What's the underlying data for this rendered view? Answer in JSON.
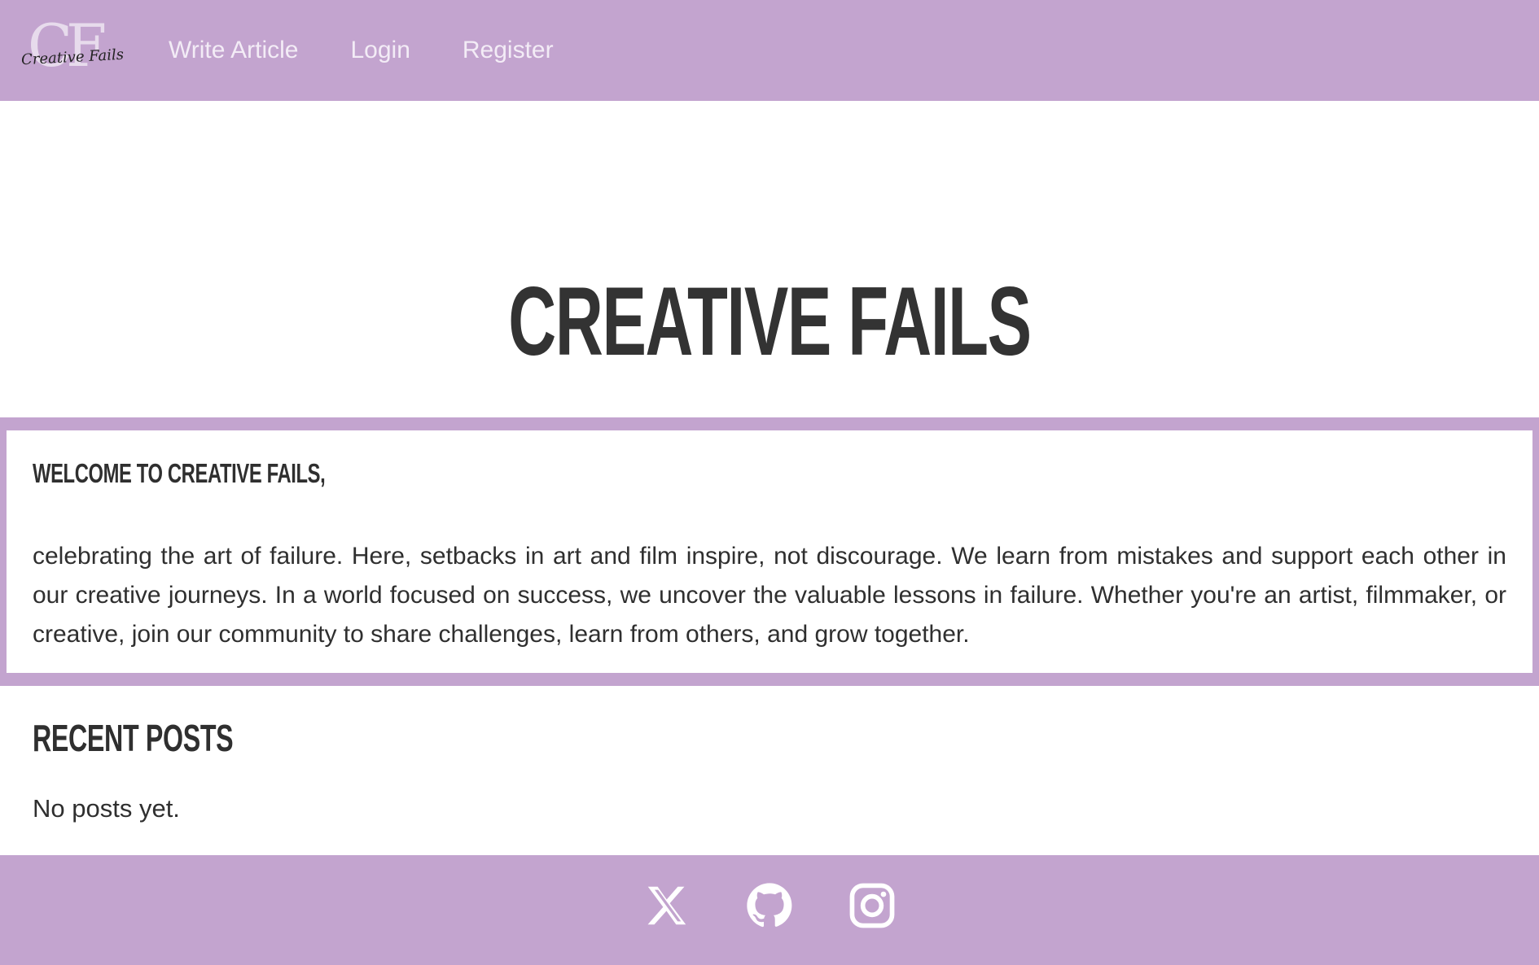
{
  "header": {
    "logo": {
      "monogram": "CF",
      "script_text": "Creative Fails"
    },
    "nav": [
      {
        "label": "Write Article"
      },
      {
        "label": "Login"
      },
      {
        "label": "Register"
      }
    ]
  },
  "hero": {
    "title": "CREATIVE FAILS"
  },
  "welcome": {
    "heading": "WELCOME TO CREATIVE FAILS,",
    "body": "celebrating the art of failure. Here, setbacks in art and film inspire, not discourage. We learn from mistakes and support each other in our creative journeys. In a world focused on success, we uncover the valuable lessons in failure. Whether you're an artist, filmmaker, or creative, join our community to share challenges, learn from others, and grow together."
  },
  "recent_posts": {
    "heading": "RECENT POSTS",
    "empty_message": "No posts yet."
  },
  "footer": {
    "social_icons": [
      "x-icon",
      "github-icon",
      "instagram-icon"
    ]
  },
  "colors": {
    "accent": "#c3a4cf",
    "nav_text": "#f3ecf6",
    "text": "#2f2f2f",
    "icon": "#ffffff"
  }
}
